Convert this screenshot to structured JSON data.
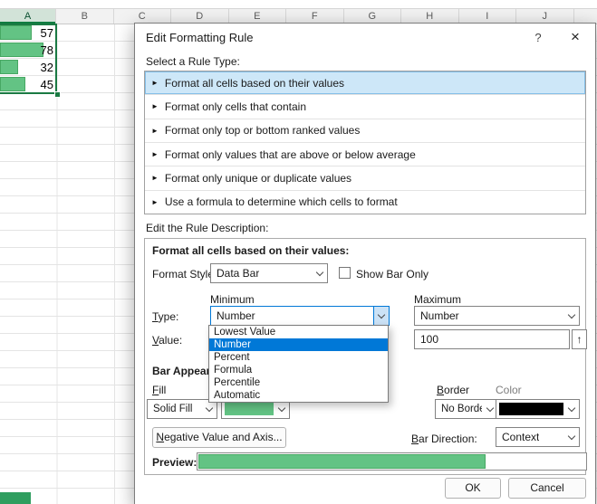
{
  "colors": {
    "data_bar_green": "#63c384",
    "data_bar_border": "#47a863",
    "selection_green": "#107c41",
    "dropdown_highlight_blue": "#0078d7",
    "border_swatch_black": "#000000"
  },
  "spreadsheet": {
    "columns": [
      "A",
      "B",
      "C",
      "D",
      "E",
      "F",
      "G",
      "H",
      "I",
      "J"
    ],
    "cells": [
      {
        "cell": "A1",
        "value": 57
      },
      {
        "cell": "A2",
        "value": 78
      },
      {
        "cell": "A3",
        "value": 32
      },
      {
        "cell": "A4",
        "value": 45
      }
    ]
  },
  "dialog": {
    "title": "Edit Formatting Rule",
    "help_glyph": "?",
    "close_glyph": "×",
    "rule_arrow": "►",
    "select_rule_label": "Select a Rule Type:",
    "rule_types": [
      "Format all cells based on their values",
      "Format only cells that contain",
      "Format only top or bottom ranked values",
      "Format only values that are above or below average",
      "Format only unique or duplicate values",
      "Use a formula to determine which cells to format"
    ],
    "selected_rule": "Format all cells based on their values",
    "edit_desc_label": "Edit the Rule Description:",
    "desc": {
      "heading": "Format all cells based on their values:",
      "format_style_label": "Format Style:",
      "format_style_value": "Data Bar",
      "show_bar_only_label": "Show Bar Only",
      "show_bar_only_checked": false,
      "minimum_label": "Minimum",
      "maximum_label": "Maximum",
      "type_label": "Type:",
      "min_type_value": "Number",
      "max_type_value": "Number",
      "value_label": "Value:",
      "max_value": "100",
      "collapse_glyph": "↑",
      "bar_appearance_label": "Bar Appearance:",
      "fill_label": "Fill",
      "fill_value": "Solid Fill",
      "border_label": "Border",
      "border_value": "No Border",
      "color_label": "Color",
      "negative_button": "Negative Value and Axis...",
      "bar_direction_label": "Bar Direction:",
      "bar_direction_value": "Context",
      "preview_label": "Preview:",
      "preview_percent": 74
    },
    "type_dropdown": {
      "options": [
        "Lowest Value",
        "Number",
        "Percent",
        "Formula",
        "Percentile",
        "Automatic"
      ],
      "selected": "Number"
    },
    "ok": "OK",
    "cancel": "Cancel"
  }
}
